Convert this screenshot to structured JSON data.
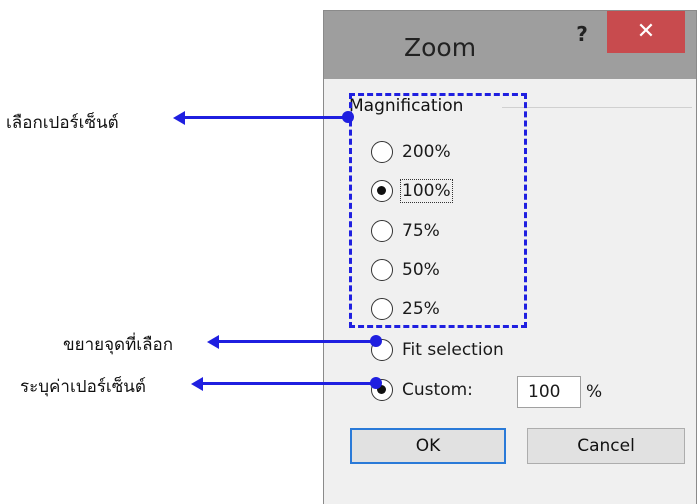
{
  "dialog": {
    "title": "Zoom",
    "help_label": "?",
    "close_label": "✕"
  },
  "magnification": {
    "group_label": "Magnification",
    "options": [
      {
        "label": "200%",
        "checked": false
      },
      {
        "label": "100%",
        "checked": true
      },
      {
        "label": "75%",
        "checked": false
      },
      {
        "label": "50%",
        "checked": false
      },
      {
        "label": "25%",
        "checked": false
      }
    ],
    "fit_selection_label": "Fit selection",
    "custom_label": "Custom:",
    "custom_value": "100",
    "custom_unit": "%"
  },
  "buttons": {
    "ok_label": "OK",
    "cancel_label": "Cancel"
  },
  "annotations": {
    "select_percent": "เลือกเปอร์เซ็นต์",
    "enlarge_selection": "ขยายจุดที่เลือก",
    "specify_percent": "ระบุค่าเปอร์เซ็นต์"
  },
  "colors": {
    "annotation_blue": "#1f1fe0",
    "close_red": "#c84b4e",
    "titlebar_gray": "#9e9e9e"
  }
}
